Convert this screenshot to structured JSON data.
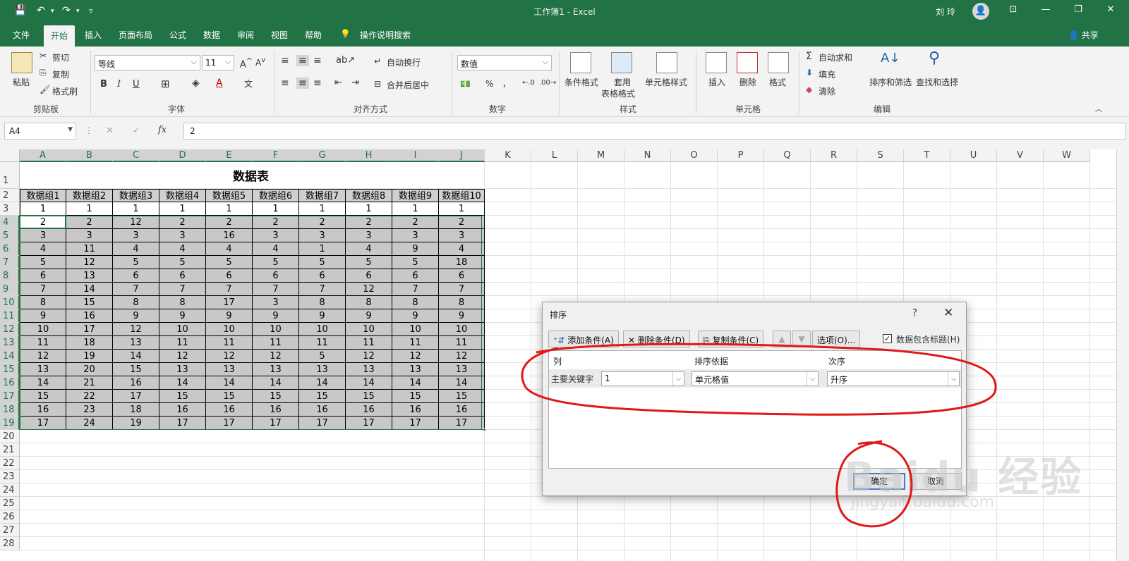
{
  "window": {
    "title": "工作簿1  -  Excel",
    "user": "刘 玲"
  },
  "quick_access": {
    "more": "▿"
  },
  "tabs": [
    "文件",
    "开始",
    "插入",
    "页面布局",
    "公式",
    "数据",
    "审阅",
    "视图",
    "帮助"
  ],
  "tell_me": "操作说明搜索",
  "share": "共享",
  "ribbon": {
    "clipboard": {
      "paste": "粘贴",
      "cut": "剪切",
      "copy": "复制",
      "format_painter": "格式刷",
      "group": "剪贴板"
    },
    "font": {
      "name": "等线",
      "size": "11",
      "bold": "B",
      "italic": "I",
      "underline": "U",
      "group": "字体"
    },
    "alignment": {
      "wrap": "自动换行",
      "merge": "合并后居中",
      "group": "对齐方式"
    },
    "number": {
      "format": "数值",
      "percent": "%",
      "comma": "，",
      "group": "数字"
    },
    "styles": {
      "conditional": "条件格式",
      "table_a": "套用",
      "table_b": "表格格式",
      "cell_styles": "单元格样式",
      "group": "样式"
    },
    "cells": {
      "insert": "插入",
      "delete": "删除",
      "format": "格式",
      "group": "单元格"
    },
    "editing": {
      "autosum": "自动求和",
      "fill": "填充",
      "clear": "清除",
      "sort_filter": "排序和筛选",
      "find_select": "查找和选择",
      "group": "编辑"
    }
  },
  "formula_bar": {
    "name_box": "A4",
    "formula": "2",
    "fx": "fx"
  },
  "sheet": {
    "columns": [
      "A",
      "B",
      "C",
      "D",
      "E",
      "F",
      "G",
      "H",
      "I",
      "J",
      "K",
      "L",
      "M",
      "N",
      "O",
      "P",
      "Q",
      "R",
      "S",
      "T",
      "U",
      "V",
      "W"
    ],
    "rows": [
      "1",
      "2",
      "3",
      "4",
      "5",
      "6",
      "7",
      "8",
      "9",
      "10",
      "11",
      "12",
      "13",
      "14",
      "15",
      "16",
      "17",
      "18",
      "19",
      "20",
      "21",
      "22",
      "23",
      "24",
      "25",
      "26",
      "27",
      "28"
    ],
    "table_title": "数据表",
    "headers": [
      "数据组1",
      "数据组2",
      "数据组3",
      "数据组4",
      "数据组5",
      "数据组6",
      "数据组7",
      "数据组8",
      "数据组9",
      "数据组10"
    ],
    "data": [
      [
        "1",
        "1",
        "1",
        "1",
        "1",
        "1",
        "1",
        "1",
        "1",
        "1"
      ],
      [
        "2",
        "2",
        "12",
        "2",
        "2",
        "2",
        "2",
        "2",
        "2",
        "2"
      ],
      [
        "3",
        "3",
        "3",
        "3",
        "16",
        "3",
        "3",
        "3",
        "3",
        "3"
      ],
      [
        "4",
        "11",
        "4",
        "4",
        "4",
        "4",
        "1",
        "4",
        "9",
        "4"
      ],
      [
        "5",
        "12",
        "5",
        "5",
        "5",
        "5",
        "5",
        "5",
        "5",
        "18"
      ],
      [
        "6",
        "13",
        "6",
        "6",
        "6",
        "6",
        "6",
        "6",
        "6",
        "6"
      ],
      [
        "7",
        "14",
        "7",
        "7",
        "7",
        "7",
        "7",
        "12",
        "7",
        "7"
      ],
      [
        "8",
        "15",
        "8",
        "8",
        "17",
        "3",
        "8",
        "8",
        "8",
        "8"
      ],
      [
        "9",
        "16",
        "9",
        "9",
        "9",
        "9",
        "9",
        "9",
        "9",
        "9"
      ],
      [
        "10",
        "17",
        "12",
        "10",
        "10",
        "10",
        "10",
        "10",
        "10",
        "10"
      ],
      [
        "11",
        "18",
        "13",
        "11",
        "11",
        "11",
        "11",
        "11",
        "11",
        "11"
      ],
      [
        "12",
        "19",
        "14",
        "12",
        "12",
        "12",
        "5",
        "12",
        "12",
        "12"
      ],
      [
        "13",
        "20",
        "15",
        "13",
        "13",
        "13",
        "13",
        "13",
        "13",
        "13"
      ],
      [
        "14",
        "21",
        "16",
        "14",
        "14",
        "14",
        "14",
        "14",
        "14",
        "14"
      ],
      [
        "15",
        "22",
        "17",
        "15",
        "15",
        "15",
        "15",
        "15",
        "15",
        "15"
      ],
      [
        "16",
        "23",
        "18",
        "16",
        "16",
        "16",
        "16",
        "16",
        "16",
        "16"
      ],
      [
        "17",
        "24",
        "19",
        "17",
        "17",
        "17",
        "17",
        "17",
        "17",
        "17"
      ]
    ]
  },
  "sort_dialog": {
    "title": "排序",
    "help": "?",
    "close": "✕",
    "add_level": "添加条件(A)",
    "delete_level": "删除条件(D)",
    "copy_level": "复制条件(C)",
    "options": "选项(O)...",
    "has_headers": "数据包含标题(H)",
    "col_header": "列",
    "sort_on_header": "排序依据",
    "order_header": "次序",
    "sort_by_label": "主要关键字",
    "sort_by_value": "1",
    "sort_on_value": "单元格值",
    "order_value": "升序",
    "ok": "确定",
    "cancel": "取消"
  },
  "watermark": {
    "logo": "Baidu 经验",
    "url": "jingyan.baidu.com"
  },
  "colors": {
    "excel_green": "#217346",
    "annotation_red": "#e01818"
  }
}
